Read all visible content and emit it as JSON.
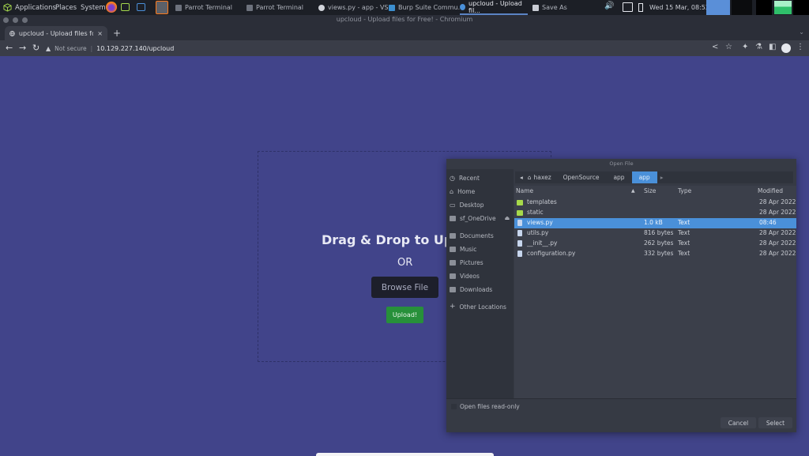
{
  "top_panel": {
    "menus": [
      "Applications",
      "Places",
      "System"
    ],
    "tasks": [
      {
        "label": "Parrot Terminal",
        "active": false
      },
      {
        "label": "Parrot Terminal",
        "active": false
      },
      {
        "label": "views.py - app - VS...",
        "active": false
      },
      {
        "label": "Burp Suite Commu...",
        "active": false
      },
      {
        "label": "upcloud - Upload fil...",
        "active": true
      },
      {
        "label": "Save As",
        "active": false
      }
    ],
    "clock": "Wed 15 Mar, 08:52"
  },
  "browser": {
    "window_title": "upcloud - Upload files for Free! - Chromium",
    "tab_title": "upcloud - Upload files for Free!",
    "tab_close": "×",
    "new_tab": "+",
    "security_label": "Not secure",
    "url": "10.129.227.140/upcloud"
  },
  "page": {
    "dropzone_title": "Drag & Drop to Upload File",
    "or_label": "OR",
    "browse_label": "Browse File",
    "upload_label": "Upload!",
    "colors": {
      "background": "#41448a",
      "upload_button": "#27903a",
      "browse_button": "#1d1f2b"
    }
  },
  "dialog": {
    "title": "Open File",
    "places": [
      {
        "label": "Recent",
        "icon": "clock-icon"
      },
      {
        "label": "Home",
        "icon": "home-icon"
      },
      {
        "label": "Desktop",
        "icon": "desktop-icon"
      },
      {
        "label": "sf_OneDrive",
        "icon": "drive-icon",
        "eject": "⏏"
      },
      {
        "label": "Documents",
        "icon": "folder-icon"
      },
      {
        "label": "Music",
        "icon": "folder-icon"
      },
      {
        "label": "Pictures",
        "icon": "folder-icon"
      },
      {
        "label": "Videos",
        "icon": "folder-icon"
      },
      {
        "label": "Downloads",
        "icon": "folder-icon"
      },
      {
        "label": "Other Locations",
        "icon": "plus-icon"
      }
    ],
    "path": [
      "haxez",
      "OpenSource",
      "app",
      "app"
    ],
    "columns": {
      "name": "Name",
      "size": "Size",
      "type": "Type",
      "modified": "Modified"
    },
    "files": [
      {
        "name": "templates",
        "size": "",
        "type": "",
        "modified": "28 Apr 2022",
        "kind": "folder",
        "selected": false
      },
      {
        "name": "static",
        "size": "",
        "type": "",
        "modified": "28 Apr 2022",
        "kind": "folder",
        "selected": false
      },
      {
        "name": "views.py",
        "size": "1.0 kB",
        "type": "Text",
        "modified": "08:46",
        "kind": "file",
        "selected": true
      },
      {
        "name": "utils.py",
        "size": "816 bytes",
        "type": "Text",
        "modified": "28 Apr 2022",
        "kind": "file",
        "selected": false
      },
      {
        "name": "__init__.py",
        "size": "262 bytes",
        "type": "Text",
        "modified": "28 Apr 2022",
        "kind": "file",
        "selected": false
      },
      {
        "name": "configuration.py",
        "size": "332 bytes",
        "type": "Text",
        "modified": "28 Apr 2022",
        "kind": "file",
        "selected": false
      }
    ],
    "read_only_label": "Open files read-only",
    "cancel_label": "Cancel",
    "select_label": "Select",
    "accent": "#4a90d9"
  }
}
